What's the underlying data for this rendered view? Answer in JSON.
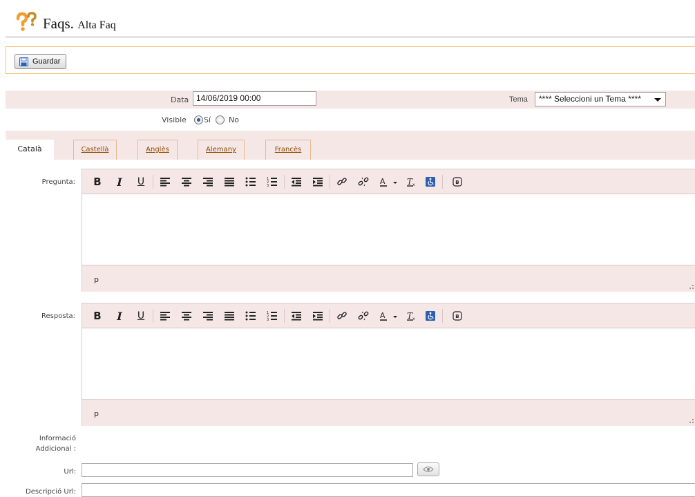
{
  "header": {
    "title": "Faqs.",
    "subtitle": "Alta Faq"
  },
  "toolbar": {
    "save_label": "Guardar"
  },
  "form": {
    "data_label": "Data",
    "data_value": "14/06/2019 00:00",
    "tema_label": "Tema",
    "tema_selected": "**** Seleccioni un Tema ****",
    "visible_label": "Visible",
    "visible_yes": "Sí",
    "visible_no": "No",
    "visible_selected": "Sí"
  },
  "tabs": [
    {
      "label": "Català",
      "active": true
    },
    {
      "label": "Castellà",
      "active": false
    },
    {
      "label": "Anglès",
      "active": false
    },
    {
      "label": "Alemany",
      "active": false
    },
    {
      "label": "Francès",
      "active": false
    }
  ],
  "editors": {
    "pregunta": {
      "label": "Pregunta:",
      "path": "p"
    },
    "resposta": {
      "label": "Resposta:",
      "path": "p"
    },
    "toolbar_icons": [
      "bold-icon",
      "italic-icon",
      "underline-icon",
      "align-left-icon",
      "align-center-icon",
      "align-right-icon",
      "align-justify-icon",
      "bulleted-list-icon",
      "numbered-list-icon",
      "outdent-icon",
      "indent-icon",
      "link-icon",
      "unlink-icon",
      "text-color-icon",
      "remove-format-icon",
      "accessibility-icon",
      "bbcode-icon"
    ],
    "bold_glyph": "B",
    "italic_glyph": "I",
    "underline_glyph": "U"
  },
  "extra": {
    "info_label_line1": "Informació",
    "info_label_line2": "Addicional :",
    "url_label": "Url:",
    "desc_label": "Descripció Url:"
  },
  "colors": {
    "accent_border": "#f1c372",
    "panel_bg": "#f6e7e7",
    "tab_link": "#8a4b00"
  }
}
